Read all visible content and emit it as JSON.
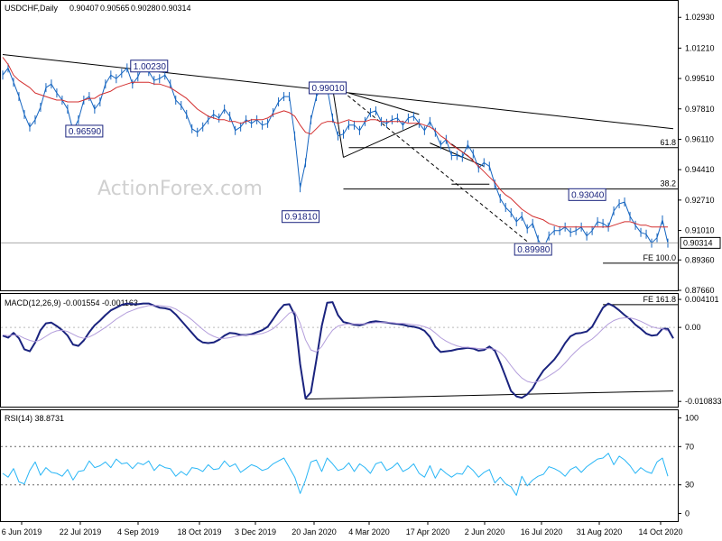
{
  "chart_data": [
    {
      "type": "line",
      "panel": "price",
      "title": "USDCHF,Daily",
      "ohlc": {
        "open": "0.90407",
        "high": "0.90565",
        "low": "0.90280",
        "close": "0.90314"
      },
      "last_value_label": "0.90314",
      "ylim": [
        0.8766,
        1.0385
      ],
      "y_ticks": [
        "1.02930",
        "1.01210",
        "0.99510",
        "0.97810",
        "0.96110",
        "0.94410",
        "0.92710",
        "0.91010",
        "0.89360",
        "0.87660"
      ],
      "x_labels": [
        "6 Jun 2019",
        "22 Jul 2019",
        "4 Sep 2019",
        "18 Oct 2019",
        "3 Dec 2019",
        "20 Jan 2020",
        "4 Mar 2020",
        "17 Apr 2020",
        "2 Jun 2020",
        "16 Jul 2020",
        "31 Aug 2020",
        "14 Oct 2020"
      ],
      "series": [
        {
          "color": "#1565c0",
          "values": [
            0.997,
            1.001,
            0.993,
            0.985,
            0.975,
            0.968,
            0.972,
            0.979,
            0.99,
            0.992,
            0.987,
            0.983,
            0.978,
            0.966,
            0.972,
            0.983,
            0.985,
            0.978,
            0.982,
            0.992,
            0.997,
            0.995,
            0.998,
            1.001,
            0.992,
            0.996,
            1.003,
            0.999,
            0.994,
            0.995,
            0.997,
            0.992,
            0.983,
            0.98,
            0.975,
            0.967,
            0.965,
            0.968,
            0.972,
            0.975,
            0.973,
            0.978,
            0.974,
            0.966,
            0.968,
            0.972,
            0.97,
            0.972,
            0.969,
            0.97,
            0.976,
            0.982,
            0.985,
            0.985,
            0.963,
            0.934,
            0.948,
            0.972,
            0.985,
            0.99,
            0.99,
            0.973,
            0.963,
            0.964,
            0.969,
            0.969,
            0.966,
            0.971,
            0.976,
            0.977,
            0.971,
            0.97,
            0.972,
            0.973,
            0.969,
            0.973,
            0.974,
            0.97,
            0.966,
            0.971,
            0.965,
            0.958,
            0.961,
            0.952,
            0.952,
            0.951,
            0.958,
            0.953,
            0.945,
            0.948,
            0.946,
            0.936,
            0.928,
            0.923,
            0.92,
            0.915,
            0.918,
            0.911,
            0.914,
            0.905,
            0.9,
            0.907,
            0.91,
            0.91,
            0.912,
            0.909,
            0.91,
            0.912,
            0.907,
            0.91,
            0.915,
            0.914,
            0.912,
            0.921,
            0.925,
            0.926,
            0.918,
            0.913,
            0.909,
            0.908,
            0.903,
            0.906,
            0.916,
            0.903
          ]
        },
        {
          "color": "#d32f2f",
          "values": [
            1.007,
            1.003,
            0.997,
            0.994,
            0.992,
            0.99,
            0.987,
            0.986,
            0.985,
            0.984,
            0.983,
            0.983,
            0.982,
            0.982,
            0.982,
            0.983,
            0.984,
            0.984,
            0.986,
            0.987,
            0.988,
            0.99,
            0.991,
            0.992,
            0.993,
            0.993,
            0.993,
            0.993,
            0.992,
            0.992,
            0.991,
            0.99,
            0.988,
            0.986,
            0.984,
            0.981,
            0.978,
            0.976,
            0.974,
            0.973,
            0.972,
            0.972,
            0.971,
            0.971,
            0.97,
            0.971,
            0.972,
            0.972,
            0.972,
            0.973,
            0.975,
            0.976,
            0.977,
            0.976,
            0.974,
            0.969,
            0.965,
            0.964,
            0.967,
            0.97,
            0.971,
            0.971,
            0.97,
            0.971,
            0.972,
            0.971,
            0.971,
            0.971,
            0.972,
            0.972,
            0.971,
            0.971,
            0.971,
            0.971,
            0.971,
            0.97,
            0.97,
            0.97,
            0.969,
            0.968,
            0.966,
            0.963,
            0.961,
            0.958,
            0.956,
            0.954,
            0.952,
            0.949,
            0.946,
            0.943,
            0.94,
            0.937,
            0.933,
            0.93,
            0.928,
            0.925,
            0.922,
            0.92,
            0.918,
            0.917,
            0.916,
            0.914,
            0.913,
            0.912,
            0.912,
            0.912,
            0.912,
            0.912,
            0.912,
            0.912,
            0.912,
            0.912,
            0.912,
            0.913,
            0.914,
            0.915,
            0.915,
            0.914,
            0.913,
            0.913,
            0.912,
            0.912,
            0.912,
            0.912
          ]
        }
      ],
      "annotations": [
        {
          "text": "0.96590",
          "kind": "box",
          "at": [
            15,
            0.9659
          ]
        },
        {
          "text": "1.00230",
          "kind": "box",
          "at": [
            27,
            1.0023
          ]
        },
        {
          "text": "0.99010",
          "kind": "box",
          "at": [
            60,
            0.9901
          ]
        },
        {
          "text": "0.91810",
          "kind": "box",
          "at": [
            55,
            0.9181
          ]
        },
        {
          "text": "0.89980",
          "kind": "box",
          "at": [
            98,
            0.8998
          ]
        },
        {
          "text": "0.93040",
          "kind": "box",
          "at": [
            108,
            0.9304
          ]
        },
        {
          "text": "61.8",
          "kind": "level",
          "value": 0.9564,
          "from": 64
        },
        {
          "text": "38.2",
          "kind": "level",
          "value": 0.9333,
          "from": 63
        },
        {
          "text": "FE 100.0",
          "kind": "level",
          "value": 0.8918,
          "from": 111
        },
        {
          "text": "FE 161.8",
          "kind": "level",
          "value": 0.8686,
          "from": 111
        }
      ],
      "trendlines": [
        {
          "color": "#000000",
          "dash": false,
          "from": [
            0,
            1.0085
          ],
          "to": [
            124,
            0.967
          ]
        },
        {
          "color": "#000000",
          "dash": false,
          "from": [
            63,
            0.951
          ],
          "to": [
            77,
            0.97
          ]
        },
        {
          "color": "#000000",
          "dash": false,
          "from": [
            64,
            0.987
          ],
          "to": [
            77,
            0.975
          ]
        },
        {
          "color": "#000000",
          "dash": false,
          "from": [
            61,
            0.99
          ],
          "to": [
            63,
            0.951
          ]
        },
        {
          "color": "#000000",
          "dash": true,
          "from": [
            62,
            0.99
          ],
          "to": [
            99,
            0.899
          ]
        },
        {
          "color": "#000000",
          "dash": false,
          "from": [
            83,
            0.9585
          ],
          "to": [
            87,
            0.9495
          ]
        },
        {
          "color": "#000000",
          "dash": false,
          "from": [
            83,
            0.936
          ],
          "to": [
            90,
            0.936
          ]
        },
        {
          "color": "#000000",
          "dash": false,
          "from": [
            79,
            0.959
          ],
          "to": [
            89,
            0.946
          ]
        }
      ]
    },
    {
      "type": "line",
      "panel": "macd",
      "title": "MACD(12,26,9) -0.001554 -0.001163",
      "ylim": [
        -0.0116,
        0.0049
      ],
      "y_ticks": [
        "0.004101",
        "0.00",
        "-0.010833"
      ],
      "series": [
        {
          "color": "#1a237e",
          "values": [
            -0.0012,
            -0.0015,
            -0.0008,
            -0.0016,
            -0.0032,
            -0.0035,
            -0.0022,
            -0.0004,
            0.0006,
            0.0007,
            0.0002,
            -0.0004,
            -0.0012,
            -0.0025,
            -0.0027,
            -0.0019,
            -0.0007,
            0.0003,
            0.001,
            0.0018,
            0.0025,
            0.0029,
            0.0033,
            0.0035,
            0.0034,
            0.0034,
            0.0035,
            0.0035,
            0.0032,
            0.0029,
            0.0028,
            0.0026,
            0.0019,
            0.001,
            0.0001,
            -0.0008,
            -0.0017,
            -0.0022,
            -0.0023,
            -0.0022,
            -0.0018,
            -0.0012,
            -0.0008,
            -0.0009,
            -0.0011,
            -0.0011,
            -0.001,
            -0.0007,
            -0.0004,
            0.0001,
            0.0012,
            0.0024,
            0.0033,
            0.0034,
            0.0018,
            -0.0054,
            -0.0104,
            -0.0095,
            -0.0048,
            0.0002,
            0.0036,
            0.0037,
            0.0018,
            0.0008,
            0.0006,
            0.0004,
            0.0003,
            0.0005,
            0.0008,
            0.0009,
            0.0008,
            0.0007,
            0.0006,
            0.0005,
            0.0004,
            0.0002,
            0.0001,
            -0.0001,
            -0.0005,
            -0.0014,
            -0.0028,
            -0.0036,
            -0.0035,
            -0.0034,
            -0.0032,
            -0.0031,
            -0.003,
            -0.0031,
            -0.0034,
            -0.0033,
            -0.0028,
            -0.0034,
            -0.0052,
            -0.0072,
            -0.0093,
            -0.0101,
            -0.0103,
            -0.0098,
            -0.0089,
            -0.0075,
            -0.0063,
            -0.0055,
            -0.0047,
            -0.0036,
            -0.0023,
            -0.0013,
            -0.0009,
            -0.0008,
            -0.0006,
            0.0001,
            0.0015,
            0.0029,
            0.0035,
            0.0031,
            0.0025,
            0.0018,
            0.0012,
            0.0004,
            -0.0002,
            -0.0009,
            -0.0012,
            -0.0011,
            -0.0002,
            -0.0002,
            -0.0016
          ]
        },
        {
          "color": "#b39ddb",
          "values": [
            -0.0011,
            -0.0012,
            -0.0011,
            -0.0012,
            -0.0016,
            -0.0019,
            -0.0021,
            -0.0018,
            -0.0013,
            -0.0008,
            -0.0005,
            -0.0004,
            -0.0006,
            -0.001,
            -0.0014,
            -0.0016,
            -0.0014,
            -0.001,
            -0.0005,
            0.0,
            0.0006,
            0.0012,
            0.0017,
            0.0022,
            0.0025,
            0.0028,
            0.003,
            0.0032,
            0.0032,
            0.0032,
            0.0031,
            0.003,
            0.0027,
            0.0022,
            0.0017,
            0.0011,
            0.0004,
            -0.0003,
            -0.0009,
            -0.0013,
            -0.0016,
            -0.0016,
            -0.0015,
            -0.0013,
            -0.0012,
            -0.0011,
            -0.0011,
            -0.001,
            -0.0009,
            -0.0006,
            -0.0002,
            0.0005,
            0.0013,
            0.0021,
            0.0023,
            0.0006,
            -0.0018,
            -0.0033,
            -0.0036,
            -0.0028,
            -0.0015,
            -0.0004,
            0.0002,
            0.0004,
            0.0005,
            0.0005,
            0.0005,
            0.0005,
            0.0006,
            0.0007,
            0.0007,
            0.0007,
            0.0007,
            0.0006,
            0.0006,
            0.0005,
            0.0004,
            0.0003,
            0.0001,
            -0.0002,
            -0.0008,
            -0.0015,
            -0.002,
            -0.0024,
            -0.0027,
            -0.0029,
            -0.0029,
            -0.003,
            -0.0031,
            -0.0031,
            -0.0031,
            -0.0032,
            -0.0037,
            -0.0045,
            -0.0056,
            -0.0066,
            -0.0074,
            -0.0079,
            -0.0081,
            -0.0079,
            -0.0076,
            -0.0071,
            -0.0066,
            -0.006,
            -0.0052,
            -0.0043,
            -0.0035,
            -0.0028,
            -0.0022,
            -0.0017,
            -0.001,
            -0.0002,
            0.0005,
            0.001,
            0.0013,
            0.0014,
            0.0014,
            0.0012,
            0.0009,
            0.0005,
            0.0001,
            -0.0001,
            -0.0002,
            -0.0005
          ]
        }
      ],
      "trendlines": [
        {
          "color": "#000000",
          "dash": false,
          "from": [
            56,
            -0.0105
          ],
          "to": [
            124,
            -0.0093
          ]
        }
      ]
    },
    {
      "type": "line",
      "panel": "rsi",
      "title": "RSI(14) 38.8731",
      "ylim": [
        -8,
        108
      ],
      "y_ticks": [
        "100",
        "70",
        "30",
        "0"
      ],
      "levels": [
        70,
        30
      ],
      "series": [
        {
          "color": "#29b6f6",
          "values": [
            42,
            38,
            47,
            33,
            31,
            45,
            54,
            40,
            48,
            43,
            42,
            39,
            46,
            35,
            44,
            45,
            55,
            48,
            50,
            54,
            48,
            57,
            52,
            53,
            47,
            53,
            51,
            55,
            45,
            51,
            48,
            47,
            39,
            44,
            40,
            48,
            47,
            44,
            51,
            46,
            47,
            55,
            49,
            52,
            43,
            47,
            51,
            49,
            45,
            47,
            52,
            55,
            58,
            48,
            38,
            21,
            35,
            54,
            56,
            44,
            58,
            52,
            45,
            47,
            53,
            44,
            52,
            48,
            42,
            52,
            54,
            45,
            48,
            53,
            44,
            47,
            52,
            42,
            38,
            50,
            37,
            47,
            42,
            38,
            42,
            41,
            50,
            45,
            38,
            43,
            46,
            32,
            38,
            31,
            28,
            19,
            39,
            29,
            35,
            39,
            41,
            49,
            47,
            44,
            39,
            46,
            49,
            43,
            49,
            53,
            57,
            58,
            63,
            51,
            60,
            56,
            50,
            42,
            48,
            44,
            42,
            54,
            58,
            39
          ]
        }
      ]
    }
  ],
  "watermark": "ActionForex.com"
}
